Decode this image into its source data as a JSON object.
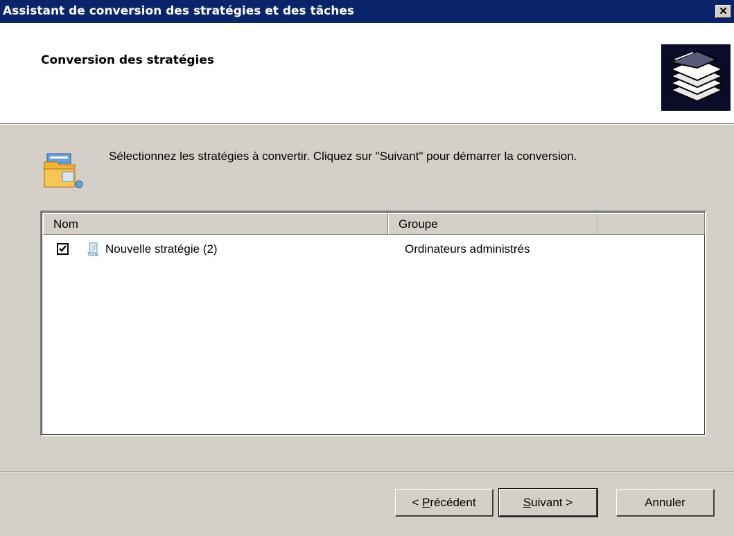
{
  "window": {
    "title": "Assistant de conversion des stratégies et des tâches",
    "close_glyph": "✕"
  },
  "header": {
    "heading": "Conversion des stratégies",
    "icon": "policy-stack-icon"
  },
  "instruction": {
    "icon": "folder-convert-icon",
    "text": "Sélectionnez les stratégies à convertir. Cliquez sur \"Suivant\" pour démarrer la conversion."
  },
  "list": {
    "columns": [
      "Nom",
      "Groupe",
      ""
    ],
    "rows": [
      {
        "checked": true,
        "icon": "policy-scroll-icon",
        "name": "Nouvelle stratégie (2)",
        "group": "Ordinateurs administrés"
      }
    ]
  },
  "buttons": {
    "back": {
      "prefix": "< ",
      "mnemonic": "P",
      "rest": "récédent"
    },
    "next": {
      "mnemonic": "S",
      "rest": "uivant >"
    },
    "cancel": "Annuler"
  },
  "colors": {
    "title_bar": "#0a246a",
    "dialog_bg": "#d4d0c8",
    "header_icon_bg": "#0b0b2a"
  }
}
